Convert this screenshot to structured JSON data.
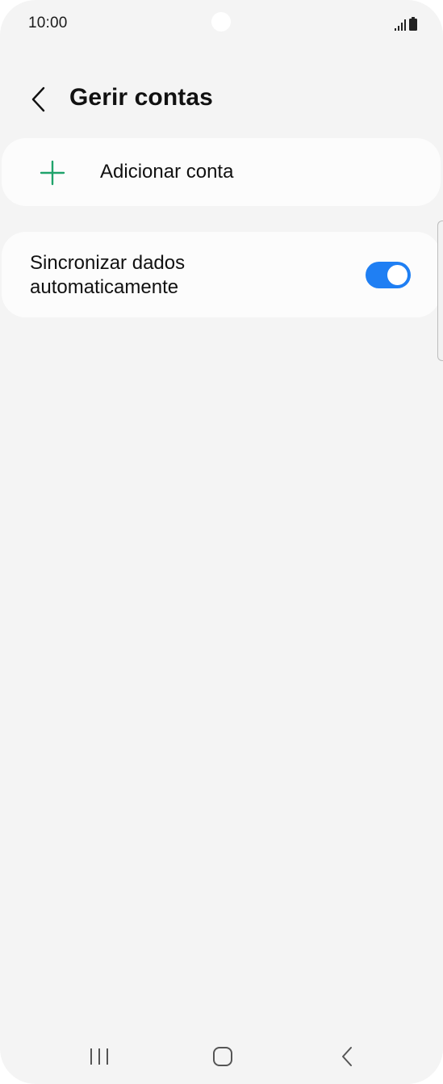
{
  "status_bar": {
    "time": "10:00",
    "icons": [
      "signal-icon",
      "battery-icon"
    ]
  },
  "header": {
    "back_icon": "chevron-left-icon",
    "title": "Gerir contas"
  },
  "add_account": {
    "icon": "plus-icon",
    "label": "Adicionar conta",
    "icon_color": "#1fa36b"
  },
  "sync": {
    "label": "Sincronizar dados automaticamente",
    "enabled": true,
    "toggle_color": "#1f7ff3"
  },
  "navigation": {
    "recents_icon": "recents-icon",
    "home_icon": "home-icon",
    "back_icon": "back-icon"
  },
  "colors": {
    "background": "#f4f4f4",
    "card": "#fcfcfc",
    "text": "#111111"
  }
}
